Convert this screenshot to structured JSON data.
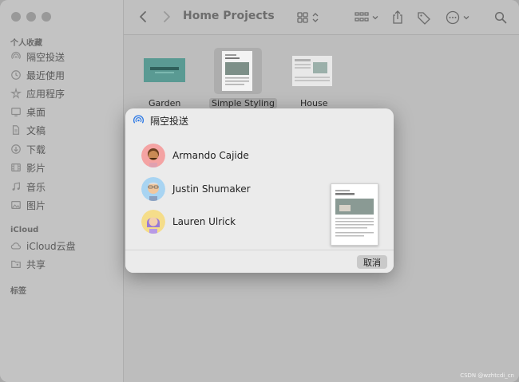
{
  "window": {
    "title": "Home Projects"
  },
  "sidebar": {
    "favorites_title": "个人收藏",
    "favorites": [
      {
        "label": "隔空投送",
        "icon": "airdrop-icon"
      },
      {
        "label": "最近使用",
        "icon": "clock-icon"
      },
      {
        "label": "应用程序",
        "icon": "applications-icon"
      },
      {
        "label": "桌面",
        "icon": "desktop-icon"
      },
      {
        "label": "文稿",
        "icon": "document-icon"
      },
      {
        "label": "下载",
        "icon": "download-icon"
      },
      {
        "label": "影片",
        "icon": "film-icon"
      },
      {
        "label": "音乐",
        "icon": "music-icon"
      },
      {
        "label": "图片",
        "icon": "photo-icon"
      }
    ],
    "icloud_title": "iCloud",
    "icloud": [
      {
        "label": "iCloud云盘",
        "icon": "cloud-icon"
      },
      {
        "label": "共享",
        "icon": "shared-folder-icon"
      }
    ],
    "tags_title": "标签"
  },
  "files": [
    {
      "label": "Garden",
      "selected": false
    },
    {
      "label": "Simple Styling",
      "selected": true
    },
    {
      "label": "House",
      "selected": false
    }
  ],
  "dialog": {
    "title": "隔空投送",
    "people": [
      {
        "name": "Armando Cajide"
      },
      {
        "name": "Justin Shumaker"
      },
      {
        "name": "Lauren Ulrick"
      }
    ],
    "cancel_label": "取消"
  },
  "watermark": "CSDN @wzhtcdi_cn"
}
